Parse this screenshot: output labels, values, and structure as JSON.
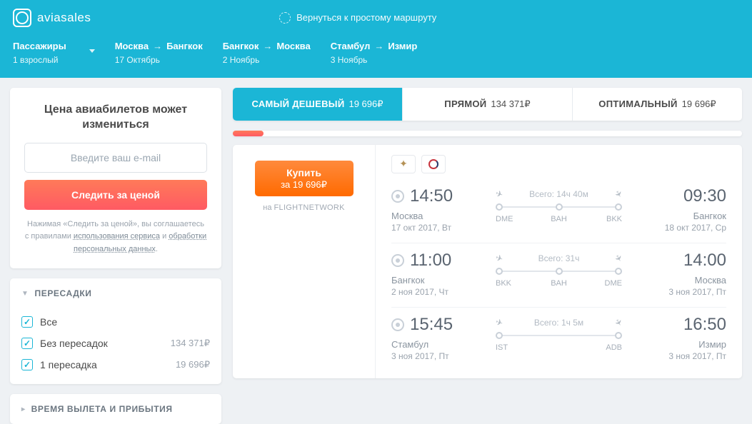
{
  "brand": "aviasales",
  "simpleRoute": "Вернуться к простому маршруту",
  "sub": {
    "passengers": {
      "label": "Пассажиры",
      "value": "1 взрослый"
    },
    "routes": [
      {
        "from": "Москва",
        "to": "Бангкок",
        "date": "17 Октябрь"
      },
      {
        "from": "Бангкок",
        "to": "Москва",
        "date": "2 Ноябрь"
      },
      {
        "from": "Стамбул",
        "to": "Измир",
        "date": "3 Ноябрь"
      }
    ]
  },
  "priceWatch": {
    "title": "Цена авиабилетов может измениться",
    "placeholder": "Введите ваш e-mail",
    "button": "Следить за ценой",
    "notePre": "Нажимая «Следить за ценой», вы соглашаетесь с правилами",
    "link1": "использования сервиса",
    "and": "и",
    "link2": "обработки персональных данных"
  },
  "filters": {
    "stops": {
      "title": "ПЕРЕСАДКИ",
      "items": [
        {
          "label": "Все",
          "price": ""
        },
        {
          "label": "Без пересадок",
          "price": "134 371₽"
        },
        {
          "label": "1 пересадка",
          "price": "19 696₽"
        }
      ]
    },
    "time": {
      "title": "ВРЕМЯ ВЫЛЕТА И ПРИБЫТИЯ"
    }
  },
  "tabs": [
    {
      "label": "САМЫЙ ДЕШЕВЫЙ",
      "price": "19 696₽",
      "active": true
    },
    {
      "label": "ПРЯМОЙ",
      "price": "134 371₽",
      "active": false
    },
    {
      "label": "ОПТИМАЛЬНЫЙ",
      "price": "19 696₽",
      "active": false
    }
  ],
  "result": {
    "buy": {
      "label": "Купить",
      "sub": "за 19 696₽",
      "srcPre": "на",
      "srcName": "FLIGHTNETWORK"
    },
    "legs": [
      {
        "dep": {
          "time": "14:50",
          "city": "Москва",
          "date": "17 окт 2017, Вт"
        },
        "arr": {
          "time": "09:30",
          "city": "Бангкок",
          "date": "18 окт 2017, Ср"
        },
        "durLabel": "Всего:",
        "dur": "14ч 40м",
        "codes": [
          "DME",
          "BAH",
          "BKK"
        ],
        "stops": 1
      },
      {
        "dep": {
          "time": "11:00",
          "city": "Бангкок",
          "date": "2 ноя 2017, Чт"
        },
        "arr": {
          "time": "14:00",
          "city": "Москва",
          "date": "3 ноя 2017, Пт"
        },
        "durLabel": "Всего:",
        "dur": "31ч",
        "codes": [
          "BKK",
          "BAH",
          "DME"
        ],
        "stops": 1
      },
      {
        "dep": {
          "time": "15:45",
          "city": "Стамбул",
          "date": "3 ноя 2017, Пт"
        },
        "arr": {
          "time": "16:50",
          "city": "Измир",
          "date": "3 ноя 2017, Пт"
        },
        "durLabel": "Всего:",
        "dur": "1ч 5м",
        "codes": [
          "IST",
          "ADB"
        ],
        "stops": 0
      }
    ]
  }
}
